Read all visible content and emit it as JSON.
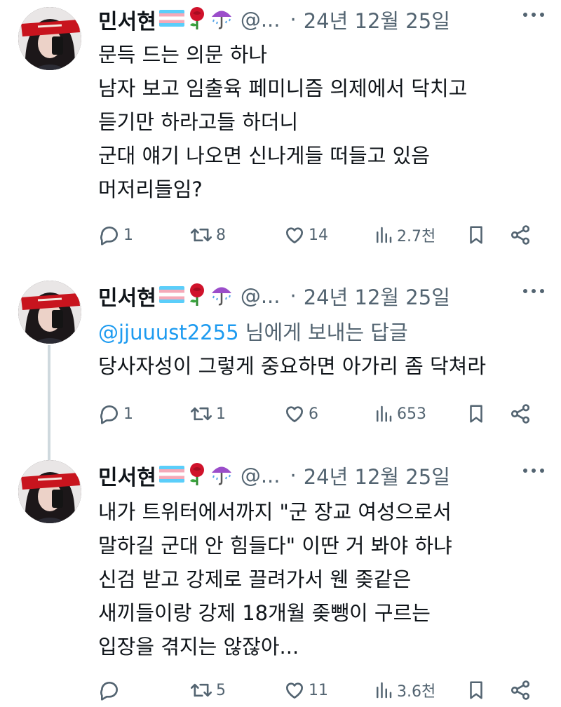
{
  "tweets": [
    {
      "name": "민서현",
      "handle": "@...",
      "separator": "·",
      "date": "24년 12월 25일",
      "emojis": [
        "transgender-flag-emoji",
        "rose-emoji",
        "umbrella-rain-emoji"
      ],
      "mention": "",
      "mention_suffix": "",
      "lines": [
        "문득 드는 의문 하나",
        "남자 보고 임출육 페미니즘 의제에서 닥치고",
        "듣기만 하라고들 하더니",
        "군대 얘기 나오면 신나게들 떠들고 있음",
        "머저리들임?"
      ],
      "stats": {
        "replies": "1",
        "retweets": "8",
        "likes": "14",
        "views": "2.7천"
      }
    },
    {
      "name": "민서현",
      "handle": "@...",
      "separator": "·",
      "date": "24년 12월 25일",
      "emojis": [
        "transgender-flag-emoji",
        "rose-emoji",
        "umbrella-rain-emoji"
      ],
      "mention": "@jjuuust2255",
      "mention_suffix": " 님에게 보내는 답글",
      "lines": [
        "당사자성이 그렇게 중요하면 아가리 좀 닥쳐라"
      ],
      "stats": {
        "replies": "1",
        "retweets": "1",
        "likes": "6",
        "views": "653"
      }
    },
    {
      "name": "민서현",
      "handle": "@...",
      "separator": "·",
      "date": "24년 12월 25일",
      "emojis": [
        "transgender-flag-emoji",
        "rose-emoji",
        "umbrella-rain-emoji"
      ],
      "mention": "",
      "mention_suffix": "",
      "lines": [
        "내가 트위터에서까지 \"군 장교 여성으로서",
        "말하길 군대 안 힘들다\" 이딴 거 봐야 하냐",
        "신검 받고 강제로 끌려가서 웬 좆같은",
        "새끼들이랑 강제 18개월 좆뺑이 구르는",
        "입장을 겪지는 않잖아..."
      ],
      "stats": {
        "replies": "",
        "retweets": "5",
        "likes": "11",
        "views": "3.6천"
      }
    }
  ],
  "colors": {
    "text": "#0f1419",
    "secondary": "#536471",
    "mention": "#1d9bf0",
    "thread_line": "#cfd9de",
    "headband": "#c8141e"
  }
}
